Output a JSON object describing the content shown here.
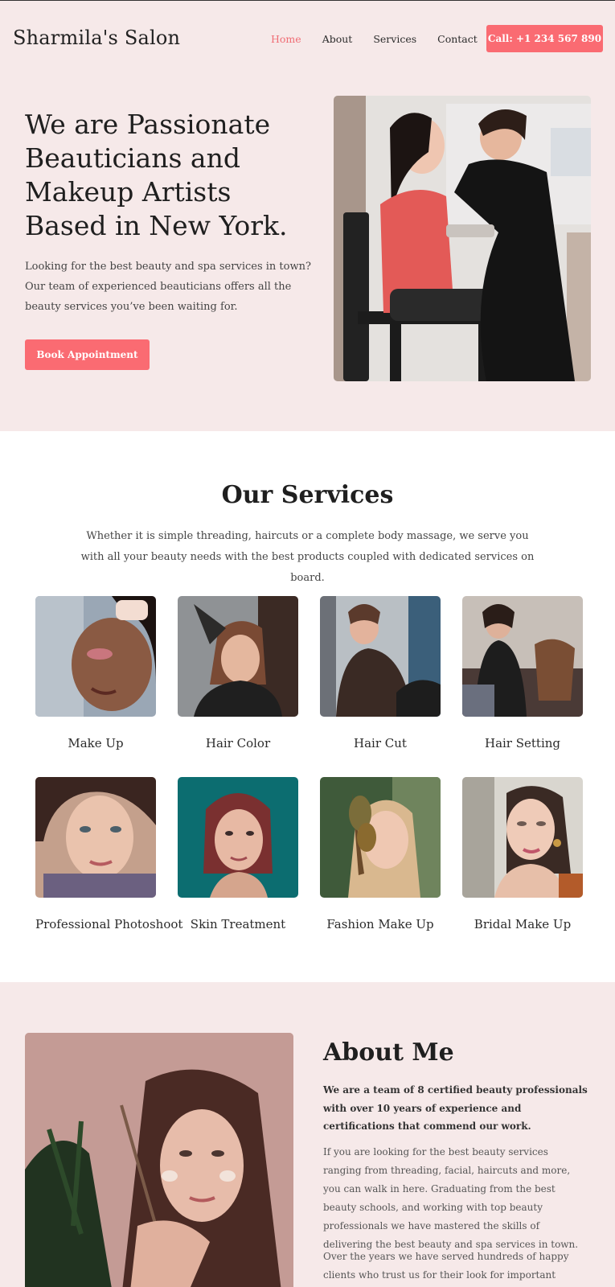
{
  "header": {
    "logo": "Sharmila's Salon",
    "nav": [
      {
        "label": "Home",
        "active": true
      },
      {
        "label": "About",
        "active": false
      },
      {
        "label": "Services",
        "active": false
      },
      {
        "label": "Contact",
        "active": false
      }
    ],
    "call_label": "Call: +1 234 567 890"
  },
  "hero": {
    "title": "We are Passionate Beauticians and Makeup Artists Based in New York.",
    "description": "Looking for the best beauty and spa services in town? Our team of experienced beauticians offers all the beauty services you’ve been waiting for.",
    "button_label": "Book Appointment"
  },
  "services": {
    "title": "Our Services",
    "description": "Whether it is simple threading, haircuts or a complete body massage, we serve you with all your beauty needs with the best products coupled with dedicated services on board.",
    "items": [
      {
        "label": "Make Up"
      },
      {
        "label": "Hair Color"
      },
      {
        "label": "Hair Cut"
      },
      {
        "label": "Hair Setting"
      },
      {
        "label": "Professional Photoshoot"
      },
      {
        "label": "Skin Treatment"
      },
      {
        "label": "Fashion Make Up"
      },
      {
        "label": "Bridal Make Up"
      }
    ]
  },
  "about": {
    "title": "About Me",
    "lead": "We are a team of 8 certified beauty professionals with over 10 years of experience and certifications that commend our work.",
    "paragraph1": "If you are looking for the best beauty services ranging from threading, facial, haircuts and more, you can walk in here. Graduating from the best beauty schools, and working with top beauty professionals we have mastered the skills of delivering the best beauty and spa services in town.",
    "paragraph2": "Over the years we have served hundreds of happy clients who trust us for their look for important occasions like"
  },
  "colors": {
    "accent": "#fa6b72",
    "background_tint": "#f6e9e9"
  }
}
